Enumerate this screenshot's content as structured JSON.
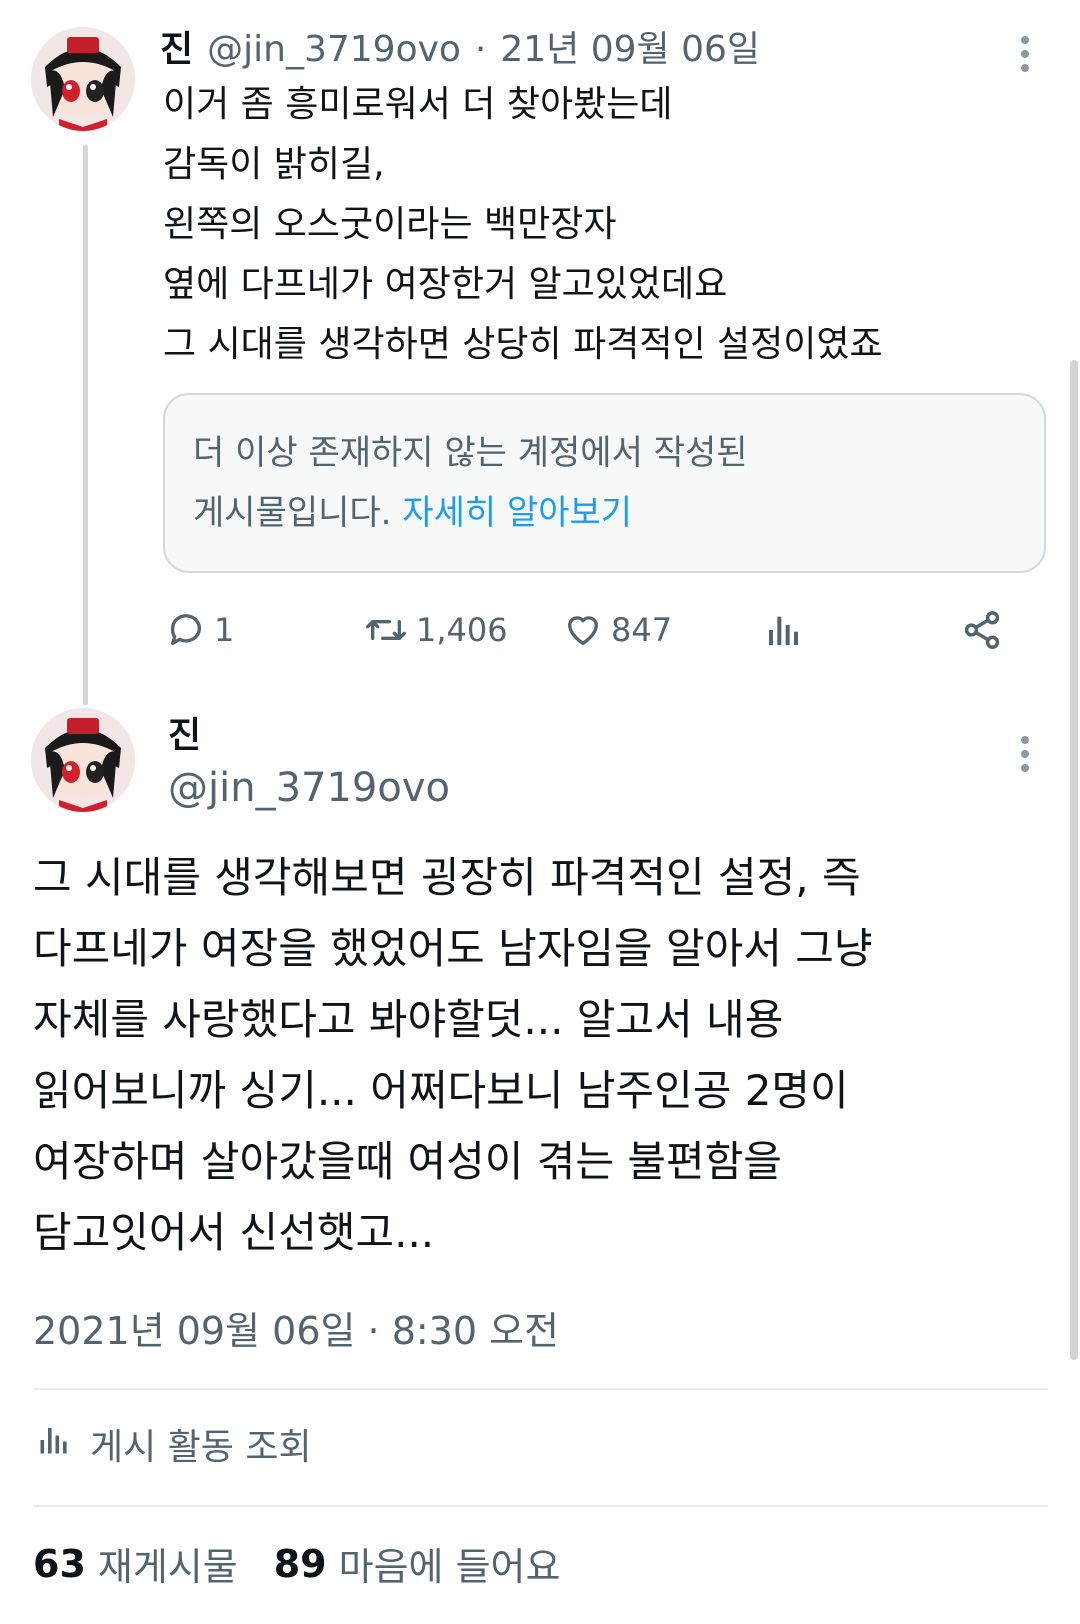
{
  "first_tweet": {
    "display_name": "진",
    "handle": "@jin_3719ovo",
    "separator": "·",
    "date": "21년 09월 06일",
    "lines": [
      "이거 좀 흥미로워서 더 찾아봤는데",
      "감독이 밝히길,",
      "왼쪽의 오스굿이라는 백만장자",
      "옆에 다프네가 여장한거 알고있었데요",
      "그 시대를 생각하면 상당히 파격적인 설정이였죠"
    ],
    "notice": {
      "line1": "더 이상 존재하지 않는 계정에서 작성된",
      "line2_prefix": "게시물입니다.",
      "link": "자세히 알아보기"
    },
    "actions": {
      "replies": "1",
      "retweets": "1,406",
      "likes": "847"
    }
  },
  "main_tweet": {
    "display_name": "진",
    "handle": "@jin_3719ovo",
    "lines": [
      "그 시대를 생각해보면 굉장히 파격적인 설정, 즉",
      "다프네가 여장을 했었어도 남자임을 알아서 그냥",
      "자체를 사랑했다고 봐야할덧... 알고서 내용",
      "읽어보니까 싱기... 어쩌다보니 남주인공 2명이",
      "여장하며 살아갔을때 여성이 겪는 불편함을",
      "담고잇어서 신선햇고..."
    ],
    "timestamp": "2021년 09월 06일 · 8:30 오전",
    "activity_label": "게시 활동 조회",
    "stats": {
      "reposts_count": "63",
      "reposts_label": "재게시물",
      "likes_count": "89",
      "likes_label": "마음에 들어요"
    }
  },
  "colors": {
    "text": "#0f1419",
    "secondary": "#536471",
    "link": "#1d9bf0",
    "border": "#cfd9de"
  },
  "icons": [
    "more-icon",
    "reply-icon",
    "retweet-icon",
    "like-icon",
    "views-icon",
    "share-icon"
  ]
}
